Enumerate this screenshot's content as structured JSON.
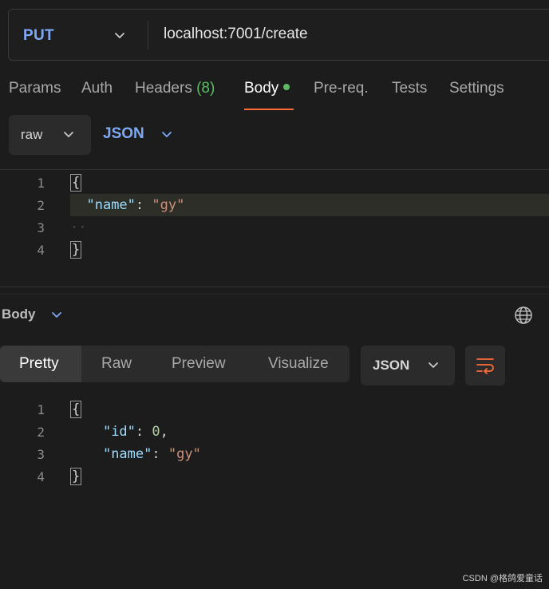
{
  "request": {
    "method": "PUT",
    "url": "localhost:7001/create"
  },
  "request_tabs": [
    {
      "label": "Params"
    },
    {
      "label": "Auth"
    },
    {
      "label": "Headers",
      "count": "(8)"
    },
    {
      "label": "Body",
      "active": true
    },
    {
      "label": "Pre-req."
    },
    {
      "label": "Tests"
    },
    {
      "label": "Settings"
    }
  ],
  "body_mode": {
    "mode": "raw",
    "language": "JSON"
  },
  "request_body_lines": {
    "numbers": [
      "1",
      "2",
      "3",
      "4"
    ],
    "line1": "{",
    "line2_key": "\"name\"",
    "line2_colon": ": ",
    "line2_value": "\"gy\"",
    "line3": "··",
    "line4": "}"
  },
  "response": {
    "section_label": "Body",
    "view_tabs": [
      "Pretty",
      "Raw",
      "Preview",
      "Visualize"
    ],
    "active_view": "Pretty",
    "format": "JSON",
    "lines": {
      "numbers": [
        "1",
        "2",
        "3",
        "4"
      ],
      "line1": "{",
      "line2_key": "\"id\"",
      "line2_colon": ": ",
      "line2_value": "0",
      "line2_comma": ",",
      "line3_key": "\"name\"",
      "line3_colon": ": ",
      "line3_value": "\"gy\"",
      "line4": "}"
    }
  },
  "watermark": "CSDN @格鸽爱童话",
  "colors": {
    "accent_tab": "#ff6c37",
    "method": "#7fa8f5",
    "dot": "#5dbb63",
    "key": "#9cdcfe",
    "string": "#ce9178",
    "number": "#b5cea8"
  },
  "icons": {
    "method_chevron": "chevron-down-icon",
    "globe": "globe-icon",
    "wrap": "wrap-lines-icon"
  }
}
